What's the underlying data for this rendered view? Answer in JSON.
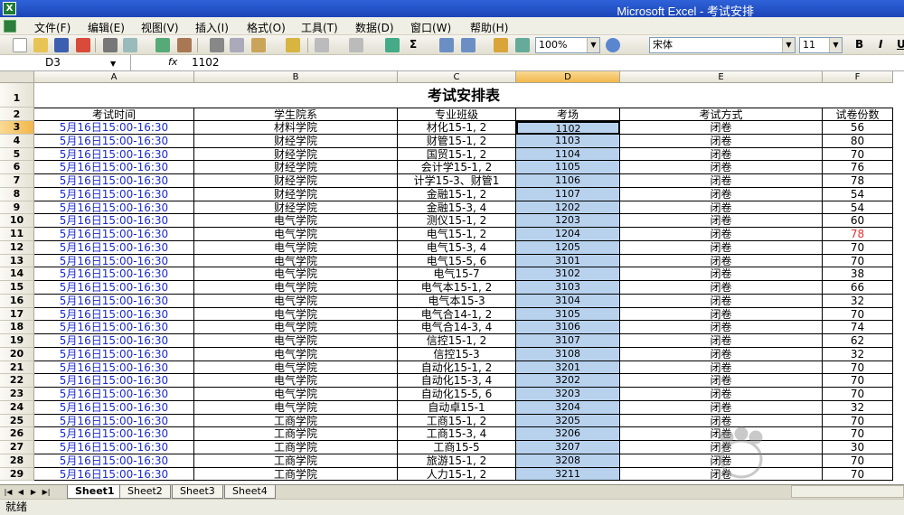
{
  "window": {
    "title": "Microsoft Excel - 考试安排",
    "app_icon": "X"
  },
  "menu": [
    "文件(F)",
    "编辑(E)",
    "视图(V)",
    "插入(I)",
    "格式(O)",
    "工具(T)",
    "数据(D)",
    "窗口(W)",
    "帮助(H)"
  ],
  "toolbar": {
    "zoom": "100%",
    "font": "宋体",
    "font_size": "11",
    "bold": "B",
    "italic": "I",
    "underline": "U",
    "sum": "Σ"
  },
  "formula_bar": {
    "name_box": "D3",
    "fx": "fx",
    "value": "1102"
  },
  "sheet": {
    "columns": [
      "A",
      "B",
      "C",
      "D",
      "E",
      "F"
    ],
    "title": "考试安排表",
    "headers": [
      "考试时间",
      "学生院系",
      "专业班级",
      "考场",
      "考试方式",
      "试卷份数"
    ],
    "rows": [
      {
        "n": "3",
        "time": "5月16日15:00-16:30",
        "dept": "材料学院",
        "cls": "材化15-1, 2",
        "room": "1102",
        "mode": "闭卷",
        "count": "56"
      },
      {
        "n": "4",
        "time": "5月16日15:00-16:30",
        "dept": "财经学院",
        "cls": "财管15-1, 2",
        "room": "1103",
        "mode": "闭卷",
        "count": "80"
      },
      {
        "n": "5",
        "time": "5月16日15:00-16:30",
        "dept": "财经学院",
        "cls": "国贸15-1, 2",
        "room": "1104",
        "mode": "闭卷",
        "count": "70"
      },
      {
        "n": "6",
        "time": "5月16日15:00-16:30",
        "dept": "财经学院",
        "cls": "会计学15-1, 2",
        "room": "1105",
        "mode": "闭卷",
        "count": "76"
      },
      {
        "n": "7",
        "time": "5月16日15:00-16:30",
        "dept": "财经学院",
        "cls": "计学15-3、财管1",
        "room": "1106",
        "mode": "闭卷",
        "count": "78"
      },
      {
        "n": "8",
        "time": "5月16日15:00-16:30",
        "dept": "财经学院",
        "cls": "金融15-1, 2",
        "room": "1107",
        "mode": "闭卷",
        "count": "54"
      },
      {
        "n": "9",
        "time": "5月16日15:00-16:30",
        "dept": "财经学院",
        "cls": "金融15-3, 4",
        "room": "1202",
        "mode": "闭卷",
        "count": "54"
      },
      {
        "n": "10",
        "time": "5月16日15:00-16:30",
        "dept": "电气学院",
        "cls": "测仪15-1, 2",
        "room": "1203",
        "mode": "闭卷",
        "count": "60"
      },
      {
        "n": "11",
        "time": "5月16日15:00-16:30",
        "dept": "电气学院",
        "cls": "电气15-1, 2",
        "room": "1204",
        "mode": "闭卷",
        "count": "78"
      },
      {
        "n": "12",
        "time": "5月16日15:00-16:30",
        "dept": "电气学院",
        "cls": "电气15-3, 4",
        "room": "1205",
        "mode": "闭卷",
        "count": "70"
      },
      {
        "n": "13",
        "time": "5月16日15:00-16:30",
        "dept": "电气学院",
        "cls": "电气15-5, 6",
        "room": "3101",
        "mode": "闭卷",
        "count": "70"
      },
      {
        "n": "14",
        "time": "5月16日15:00-16:30",
        "dept": "电气学院",
        "cls": "电气15-7",
        "room": "3102",
        "mode": "闭卷",
        "count": "38"
      },
      {
        "n": "15",
        "time": "5月16日15:00-16:30",
        "dept": "电气学院",
        "cls": "电气本15-1, 2",
        "room": "3103",
        "mode": "闭卷",
        "count": "66"
      },
      {
        "n": "16",
        "time": "5月16日15:00-16:30",
        "dept": "电气学院",
        "cls": "电气本15-3",
        "room": "3104",
        "mode": "闭卷",
        "count": "32"
      },
      {
        "n": "17",
        "time": "5月16日15:00-16:30",
        "dept": "电气学院",
        "cls": "电气合14-1, 2",
        "room": "3105",
        "mode": "闭卷",
        "count": "70"
      },
      {
        "n": "18",
        "time": "5月16日15:00-16:30",
        "dept": "电气学院",
        "cls": "电气合14-3, 4",
        "room": "3106",
        "mode": "闭卷",
        "count": "74"
      },
      {
        "n": "19",
        "time": "5月16日15:00-16:30",
        "dept": "电气学院",
        "cls": "信控15-1, 2",
        "room": "3107",
        "mode": "闭卷",
        "count": "62"
      },
      {
        "n": "20",
        "time": "5月16日15:00-16:30",
        "dept": "电气学院",
        "cls": "信控15-3",
        "room": "3108",
        "mode": "闭卷",
        "count": "32"
      },
      {
        "n": "21",
        "time": "5月16日15:00-16:30",
        "dept": "电气学院",
        "cls": "自动化15-1, 2",
        "room": "3201",
        "mode": "闭卷",
        "count": "70"
      },
      {
        "n": "22",
        "time": "5月16日15:00-16:30",
        "dept": "电气学院",
        "cls": "自动化15-3, 4",
        "room": "3202",
        "mode": "闭卷",
        "count": "70"
      },
      {
        "n": "23",
        "time": "5月16日15:00-16:30",
        "dept": "电气学院",
        "cls": "自动化15-5, 6",
        "room": "3203",
        "mode": "闭卷",
        "count": "70"
      },
      {
        "n": "24",
        "time": "5月16日15:00-16:30",
        "dept": "电气学院",
        "cls": "自动卓15-1",
        "room": "3204",
        "mode": "闭卷",
        "count": "32"
      },
      {
        "n": "25",
        "time": "5月16日15:00-16:30",
        "dept": "工商学院",
        "cls": "工商15-1, 2",
        "room": "3205",
        "mode": "闭卷",
        "count": "70"
      },
      {
        "n": "26",
        "time": "5月16日15:00-16:30",
        "dept": "工商学院",
        "cls": "工商15-3, 4",
        "room": "3206",
        "mode": "闭卷",
        "count": "70"
      },
      {
        "n": "27",
        "time": "5月16日15:00-16:30",
        "dept": "工商学院",
        "cls": "工商15-5",
        "room": "3207",
        "mode": "闭卷",
        "count": "30"
      },
      {
        "n": "28",
        "time": "5月16日15:00-16:30",
        "dept": "工商学院",
        "cls": "旅游15-1, 2",
        "room": "3208",
        "mode": "闭卷",
        "count": "70"
      },
      {
        "n": "29",
        "time": "5月16日15:00-16:30",
        "dept": "工商学院",
        "cls": "人力15-1, 2",
        "room": "3211",
        "mode": "闭卷",
        "count": "70"
      }
    ],
    "highlight": {
      "row": "11",
      "color": "#e83030"
    }
  },
  "tabs": [
    "Sheet1",
    "Sheet2",
    "Sheet3",
    "Sheet4"
  ],
  "status": "就绪",
  "colors": {
    "title_bar": "#2f62d8",
    "selected_header": "#f2b74b",
    "column_d_fill": "#b8d2ee",
    "time_text": "#1a2ad0"
  }
}
